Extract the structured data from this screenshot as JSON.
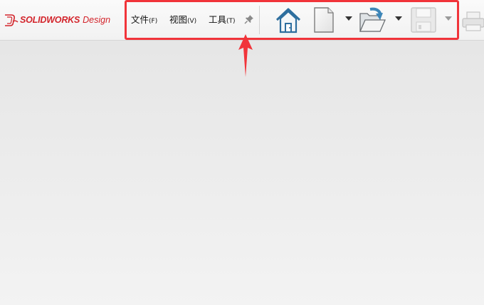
{
  "app": {
    "brand": "SOLIDWORKS",
    "product": "Design"
  },
  "menu": [
    {
      "label": "文件",
      "key": "(F)"
    },
    {
      "label": "视图",
      "key": "(V)"
    },
    {
      "label": "工具",
      "key": "(T)"
    }
  ],
  "toolbar": {
    "buttons": [
      "home-icon",
      "new-document-icon",
      "open-folder-icon",
      "save-icon",
      "print-icon"
    ],
    "save_enabled": false
  },
  "colors": {
    "brand_red": "#d3242b",
    "highlight_red": "#f1343a",
    "icon_blue": "#2d6e9e"
  }
}
